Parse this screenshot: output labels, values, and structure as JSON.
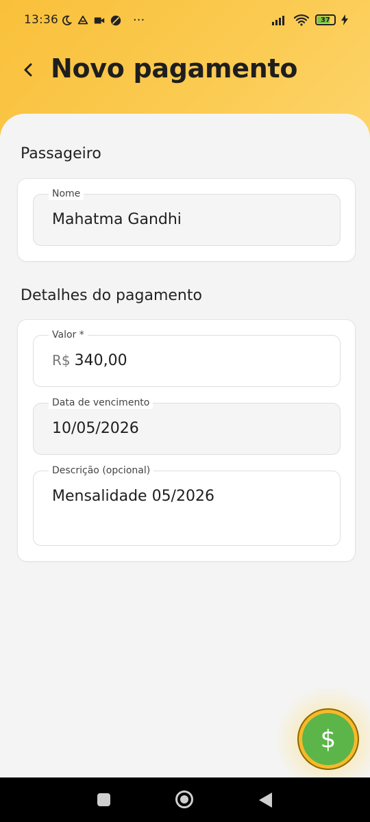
{
  "status_bar": {
    "time": "13:36",
    "more": "···",
    "battery": "37",
    "icons_left": [
      "moon-icon",
      "drive-icon",
      "video-icon",
      "vpn-icon"
    ],
    "icons_right": [
      "signal-icon",
      "wifi-icon",
      "battery-icon",
      "charging-icon"
    ]
  },
  "header": {
    "title": "Novo pagamento",
    "back_icon": "chevron-left-icon",
    "color_top": "#f9c03a"
  },
  "passenger_section": {
    "title": "Passageiro",
    "name_label": "Nome",
    "name_value": "Mahatma Gandhi"
  },
  "payment_section": {
    "title": "Detalhes do pagamento",
    "amount_label": "Valor *",
    "amount_prefix": "R$",
    "amount_value": "340,00",
    "due_date_label": "Data de vencimento",
    "due_date_value": "10/05/2026",
    "description_label": "Descrição (opcional)",
    "description_value": "Mensalidade 05/2026"
  },
  "fab": {
    "symbol": "$",
    "icon": "dollar-icon",
    "color": "#5cb548"
  },
  "nav_bar": {
    "icons": [
      "recents-icon",
      "home-icon",
      "back-icon"
    ]
  }
}
